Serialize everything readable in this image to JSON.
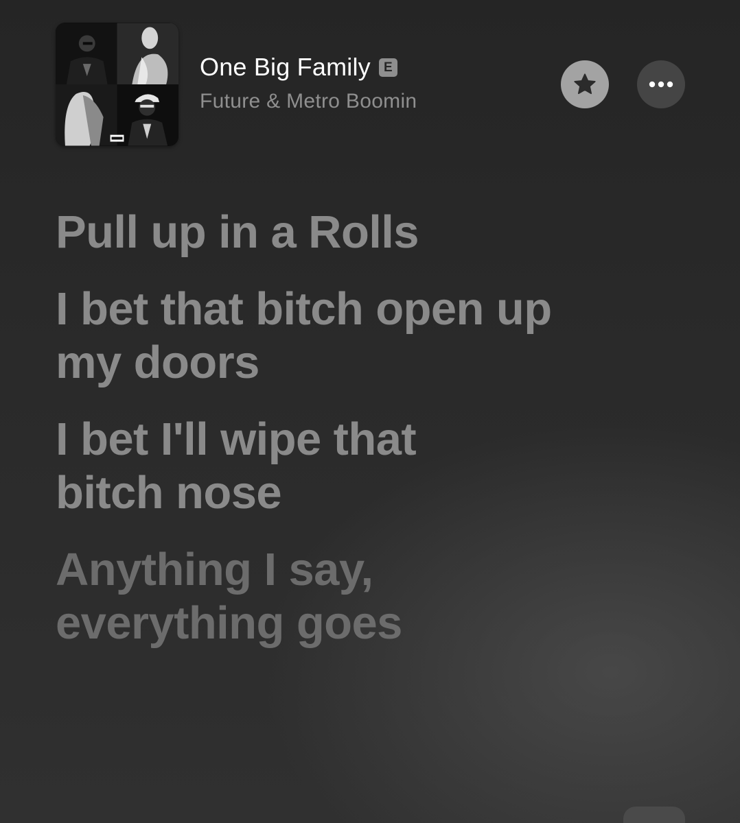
{
  "header": {
    "song_title": "One Big Family",
    "explicit_badge": "E",
    "artist": "Future & Metro Boomin",
    "artwork_icon": "album-artwork",
    "favorite_icon": "star-icon",
    "more_icon": "ellipsis-icon"
  },
  "lyrics": {
    "lines": [
      "Pull up in a Rolls",
      "I bet that bitch open up\nmy doors",
      "I bet I'll wipe that\nbitch nose",
      "Anything I say,\neverything goes"
    ]
  },
  "colors": {
    "background": "#262626",
    "title": "#ffffff",
    "artist": "#8f8f8f",
    "lyric": "#8a8a8a",
    "favorite_button": "#a3a3a3",
    "more_button": "#454545"
  }
}
